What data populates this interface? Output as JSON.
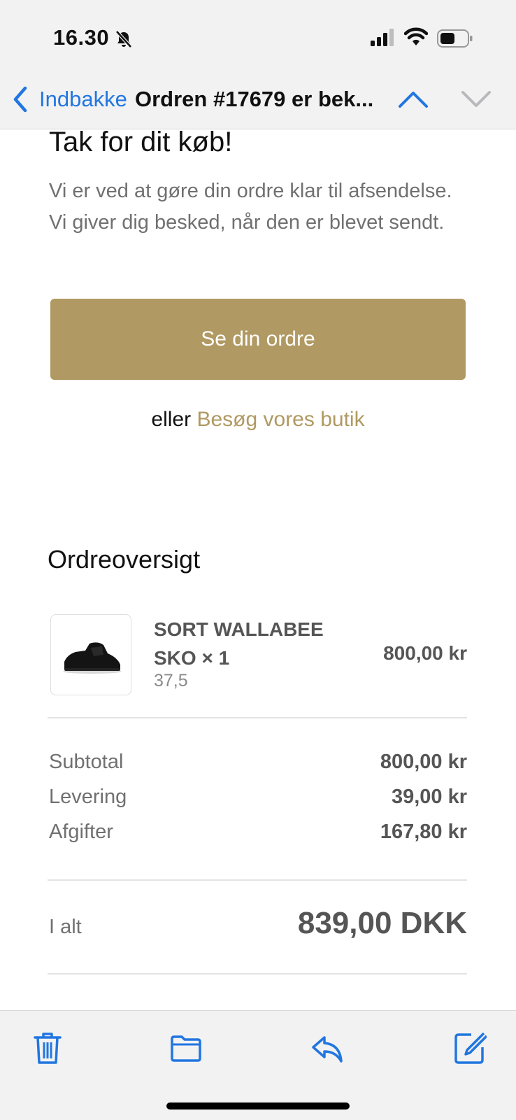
{
  "status_bar": {
    "time": "16.30"
  },
  "nav": {
    "back_label": "Indbakke",
    "title": "Ordren #17679 er bek..."
  },
  "email": {
    "heading": "Tak for dit køb!",
    "body": "Vi er ved at gøre din ordre klar til afsendelse. Vi giver dig besked, når den er blevet sendt.",
    "cta_label": "Se din ordre",
    "or_text": "eller",
    "store_link": "Besøg vores butik",
    "summary_title": "Ordreoversigt",
    "product": {
      "name": "SORT WALLABEE SKO × 1",
      "variant": "37,5",
      "price": "800,00 kr"
    },
    "totals": {
      "subtotal_label": "Subtotal",
      "subtotal_value": "800,00 kr",
      "shipping_label": "Levering",
      "shipping_value": "39,00 kr",
      "tax_label": "Afgifter",
      "tax_value": "167,80 kr",
      "total_label": "I alt",
      "total_value": "839,00 DKK"
    }
  },
  "colors": {
    "accent_blue": "#2176e0",
    "brand_gold": "#b09962"
  },
  "icons": {
    "toolbar": [
      "trash-icon",
      "folder-icon",
      "reply-icon",
      "compose-icon"
    ]
  }
}
